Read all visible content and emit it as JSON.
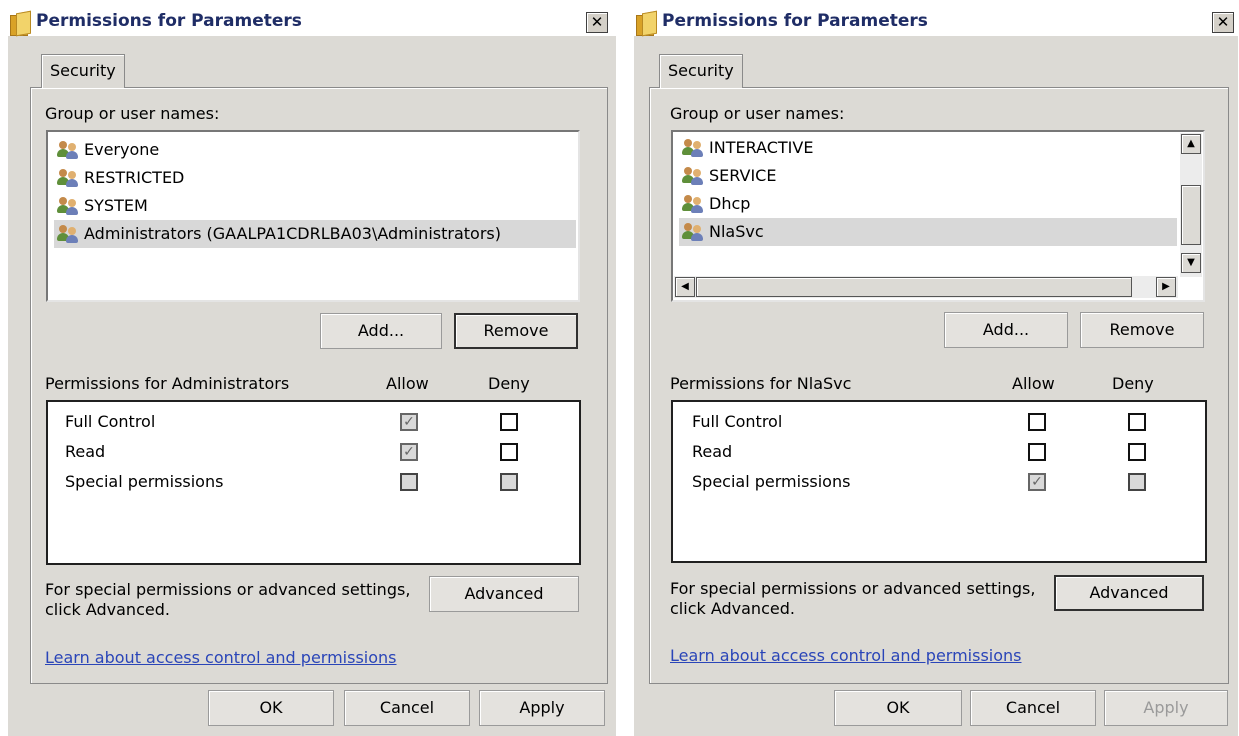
{
  "left": {
    "title": "Permissions for Parameters",
    "close": "✕",
    "tab": "Security",
    "group_label": "Group or user names:",
    "users": [
      {
        "name": "Everyone"
      },
      {
        "name": "RESTRICTED"
      },
      {
        "name": "SYSTEM"
      },
      {
        "name": "Administrators (GAALPA1CDRLBA03\\Administrators)"
      }
    ],
    "add_label": "Add...",
    "remove_label": "Remove",
    "perm_header": "Permissions for Administrators",
    "allow_label": "Allow",
    "deny_label": "Deny",
    "permissions": [
      {
        "name": "Full Control",
        "allow": "✓",
        "deny": ""
      },
      {
        "name": "Read",
        "allow": "✓",
        "deny": ""
      },
      {
        "name": "Special permissions",
        "allow": "",
        "deny": ""
      }
    ],
    "advanced_text_line1": "For special permissions or advanced settings,",
    "advanced_text_line2": "click Advanced.",
    "advanced_label": "Advanced",
    "learn_link": "Learn about access control and permissions",
    "ok_label": "OK",
    "cancel_label": "Cancel",
    "apply_label": "Apply"
  },
  "right": {
    "title": "Permissions for Parameters",
    "close": "✕",
    "tab": "Security",
    "group_label": "Group or user names:",
    "users": [
      {
        "name": "INTERACTIVE"
      },
      {
        "name": "SERVICE"
      },
      {
        "name": "Dhcp"
      },
      {
        "name": "NlaSvc"
      }
    ],
    "add_label": "Add...",
    "remove_label": "Remove",
    "perm_header": "Permissions for NlaSvc",
    "allow_label": "Allow",
    "deny_label": "Deny",
    "permissions": [
      {
        "name": "Full Control",
        "allow": "",
        "deny": ""
      },
      {
        "name": "Read",
        "allow": "",
        "deny": ""
      },
      {
        "name": "Special permissions",
        "allow": "✓",
        "deny": ""
      }
    ],
    "advanced_text_line1": "For special permissions or advanced settings,",
    "advanced_text_line2": "click Advanced.",
    "advanced_label": "Advanced",
    "learn_link": "Learn about access control and permissions",
    "ok_label": "OK",
    "cancel_label": "Cancel",
    "apply_label": "Apply",
    "scroll_up": "▲",
    "scroll_down": "▼",
    "scroll_left": "◀",
    "scroll_right": "▶"
  }
}
